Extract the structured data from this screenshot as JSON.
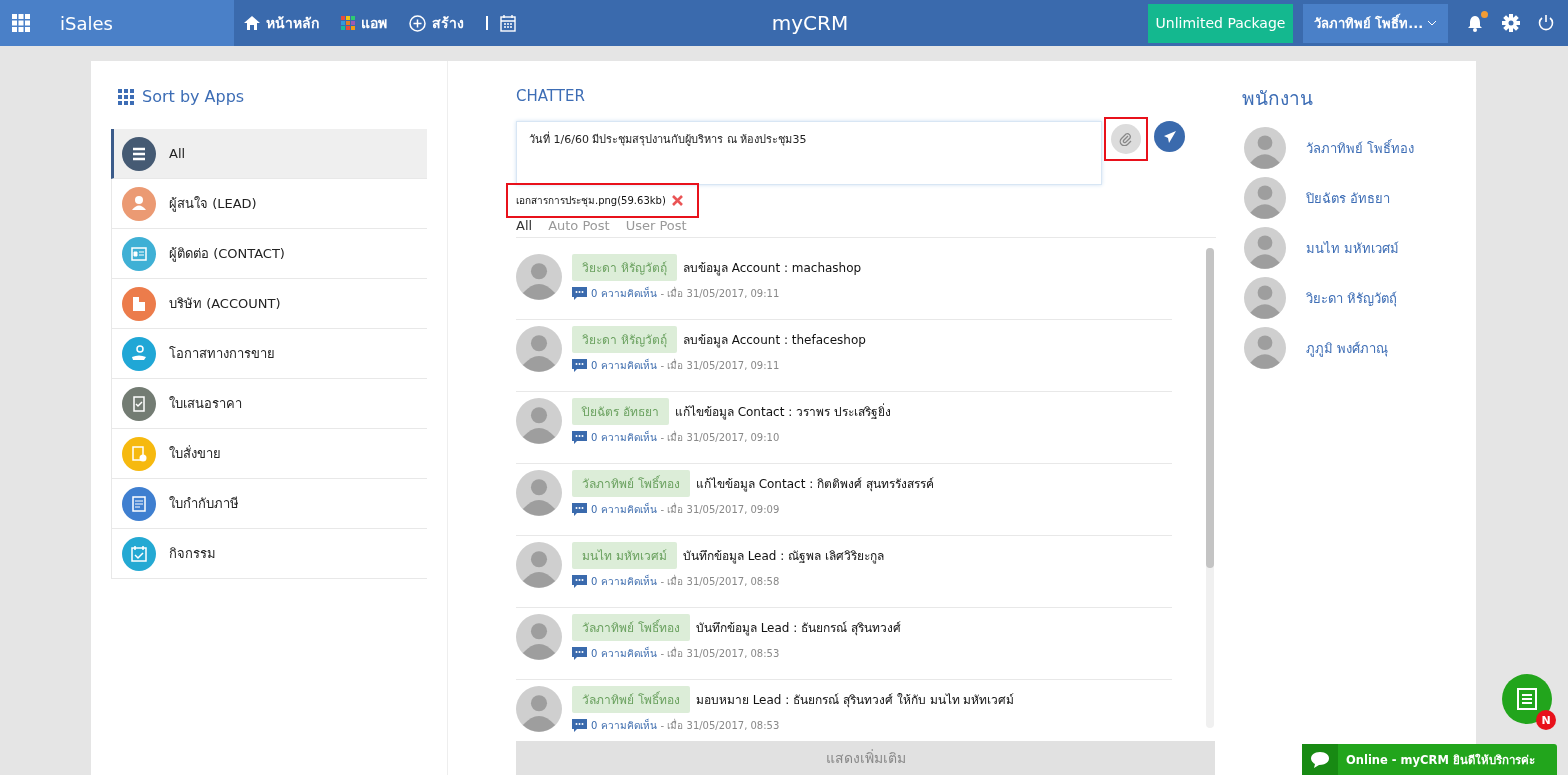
{
  "topbar": {
    "app_name": "iSales",
    "nav": [
      {
        "kind": "home",
        "label": "หน้าหลัก"
      },
      {
        "kind": "apps",
        "label": "แอพ"
      },
      {
        "kind": "create",
        "label": "สร้าง"
      },
      {
        "kind": "calendar"
      }
    ],
    "logo": "myCRM",
    "package_button": "Unlimited Package",
    "user_menu": "วัลภาทิพย์ โพธิ์ท...",
    "has_notification": true
  },
  "sidebar": {
    "title": "Sort by Apps",
    "items": [
      {
        "label": "All",
        "selected": true,
        "color": "#455a73"
      },
      {
        "label": "ผู้สนใจ (LEAD)",
        "selected": false,
        "color": "#eb9a73"
      },
      {
        "label": "ผู้ติดต่อ (CONTACT)",
        "selected": false,
        "color": "#3fb0d5"
      },
      {
        "label": "บริษัท (ACCOUNT)",
        "selected": false,
        "color": "#ec7c4b"
      },
      {
        "label": "โอกาสทางการขาย",
        "selected": false,
        "color": "#20a7d6"
      },
      {
        "label": "ใบเสนอราคา",
        "selected": false,
        "color": "#737c73"
      },
      {
        "label": "ใบสั่งขาย",
        "selected": false,
        "color": "#f6b90f"
      },
      {
        "label": "ใบกำกับภาษี",
        "selected": false,
        "color": "#3f7fd0"
      },
      {
        "label": "กิจกรรม",
        "selected": false,
        "color": "#24a9d3"
      }
    ]
  },
  "chatter": {
    "title": "CHATTER",
    "composer": {
      "value": "วันที่ 1/6/60 มีประชุมสรุปงานกับผู้บริหาร ณ ห้องประชุม35"
    },
    "attachment": "เอกสารการประชุม.png(59.63kb)",
    "filters": [
      {
        "label": "All",
        "selected": true
      },
      {
        "label": "Auto Post",
        "selected": false
      },
      {
        "label": "User Post",
        "selected": false
      }
    ],
    "posts": [
      {
        "author": "วิยะดา หิรัญวัตถุ์",
        "action": "ลบข้อมูล Account : machashop",
        "comments": "0 ความคิดเห็น",
        "time": "- เมื่อ 31/05/2017, 09:11"
      },
      {
        "author": "วิยะดา หิรัญวัตถุ์",
        "action": "ลบข้อมูล Account : thefaceshop",
        "comments": "0 ความคิดเห็น",
        "time": "- เมื่อ 31/05/2017, 09:11"
      },
      {
        "author": "ปิยฉัตร อัทธยา",
        "action": "แก้ไขข้อมูล Contact : วราพร ประเสริฐยิ่ง",
        "comments": "0 ความคิดเห็น",
        "time": "- เมื่อ 31/05/2017, 09:10"
      },
      {
        "author": "วัลภาทิพย์ โพธิ์ทอง",
        "action": "แก้ไขข้อมูล Contact : กิตติพงศ์ สุนทรรังสรรค์",
        "comments": "0 ความคิดเห็น",
        "time": "- เมื่อ 31/05/2017, 09:09"
      },
      {
        "author": "มนไท มหัทเวศม์",
        "action": "บันทึกข้อมูล Lead : ณัฐพล เลิศวิริยะกูล",
        "comments": "0 ความคิดเห็น",
        "time": "- เมื่อ 31/05/2017, 08:58"
      },
      {
        "author": "วัลภาทิพย์ โพธิ์ทอง",
        "action": "บันทึกข้อมูล Lead : ธันยกรณ์ สุรินทวงศ์",
        "comments": "0 ความคิดเห็น",
        "time": "- เมื่อ 31/05/2017, 08:53"
      },
      {
        "author": "วัลภาทิพย์ โพธิ์ทอง",
        "action": "มอบหมาย Lead : ธันยกรณ์ สุรินทวงศ์ ให้กับ มนไท มหัทเวศม์",
        "comments": "0 ความคิดเห็น",
        "time": "- เมื่อ 31/05/2017, 08:53"
      }
    ],
    "show_more": "แสดงเพิ่มเติม"
  },
  "employees": {
    "title": "พนักงาน",
    "items": [
      {
        "name": "วัลภาทิพย์ โพธิ์ทอง"
      },
      {
        "name": "ปิยฉัตร อัทธยา"
      },
      {
        "name": "มนไท มหัทเวศม์"
      },
      {
        "name": "วิยะดา หิรัญวัตถุ์"
      },
      {
        "name": "ภูภูมิ พงศ์ภาณุ"
      }
    ]
  },
  "floating_badge": "N",
  "chat_widget": "Online - myCRM ยินดีให้บริการค่ะ"
}
